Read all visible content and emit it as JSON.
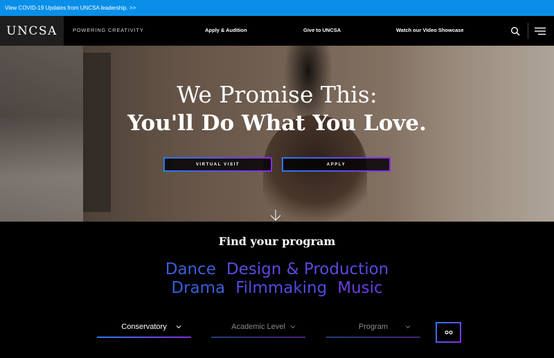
{
  "alert": {
    "text": "View COVID-19 Updates from UNCSA leadership. >>"
  },
  "header": {
    "logo": "UNCSA",
    "tagline": "POWERING CREATIVITY",
    "nav": [
      {
        "label": "Apply & Audition"
      },
      {
        "label": "Give to UNCSA"
      },
      {
        "label": "Watch our Video Showcase"
      }
    ],
    "icons": {
      "search": "search-icon",
      "menu": "hamburger-menu-icon"
    }
  },
  "hero": {
    "line1": "We Promise This:",
    "line2": "You'll Do What You Love.",
    "buttons": [
      {
        "label": "VIRTUAL VISIT"
      },
      {
        "label": "APPLY"
      }
    ],
    "scroll_icon": "arrow-down-icon"
  },
  "programs": {
    "title": "Find your program",
    "row1": [
      {
        "label": "Dance",
        "color": "#3a5fd9"
      },
      {
        "label": "Design & Production",
        "color": "#5a4ae0"
      }
    ],
    "row2": [
      {
        "label": "Drama",
        "color": "#3a5fd9"
      },
      {
        "label": "Filmmaking",
        "color": "#4f4ce0"
      },
      {
        "label": "Music",
        "color": "#6a3ee2"
      }
    ],
    "filters": [
      {
        "label": "Conservatory"
      },
      {
        "label": "Academic Level"
      },
      {
        "label": "Program"
      }
    ],
    "go_icon": "go-icon",
    "accent_blue": "#2a7bf0",
    "accent_purple": "#8a2be2"
  }
}
